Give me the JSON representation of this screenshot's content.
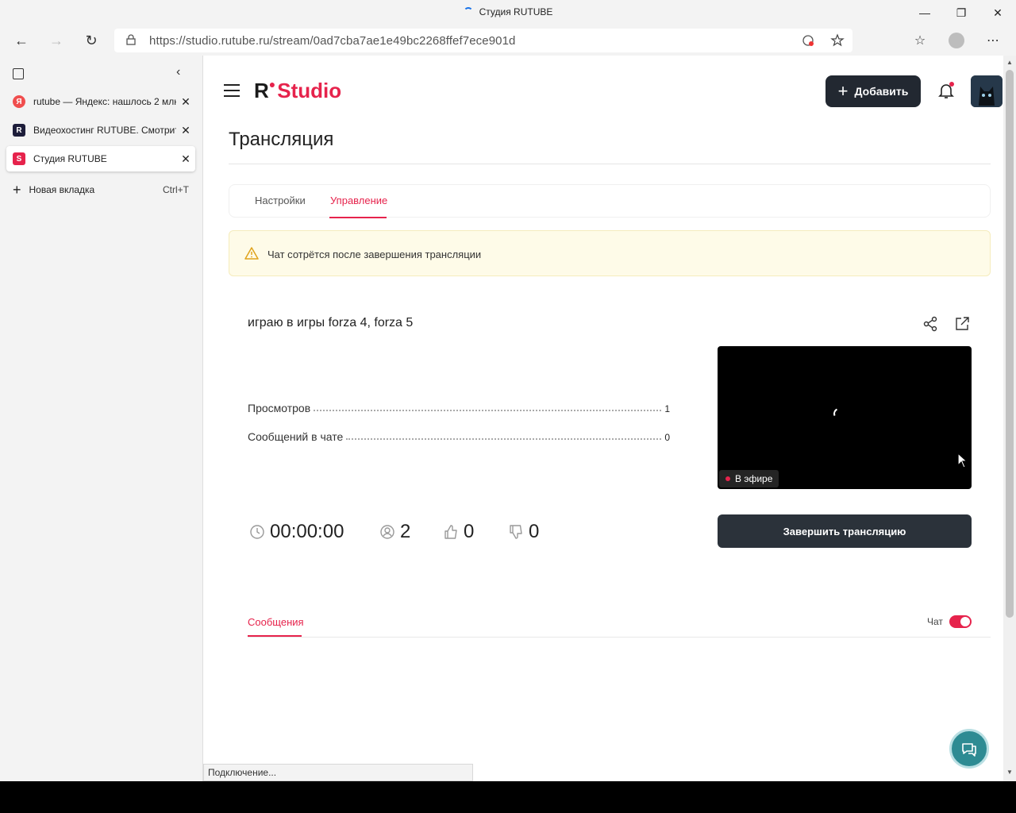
{
  "window": {
    "title": "Студия RUTUBE"
  },
  "browser": {
    "url": "https://studio.rutube.ru/stream/0ad7cba7ae1e49bc2268ffef7ece901d",
    "tabs": [
      {
        "label": "rutube — Яндекс: нашлось 2 млн результатов",
        "favicon": "Я",
        "favicon_color": "#f04e4e"
      },
      {
        "label": "Видеохостинг RUTUBE. Смотрите видео онлайн",
        "favicon": "R",
        "favicon_color": "#1d1d3a"
      },
      {
        "label": "Студия RUTUBE",
        "favicon": "S",
        "favicon_color": "#e6234c"
      }
    ],
    "new_tab": {
      "label": "Новая вкладка",
      "shortcut": "Ctrl+T"
    },
    "status_text": "Подключение..."
  },
  "app": {
    "logo_r": "R",
    "logo_studio": "Studio",
    "add_button": "Добавить",
    "page_title": "Трансляция",
    "tabs": [
      {
        "label": "Настройки"
      },
      {
        "label": "Управление"
      }
    ],
    "warning": "Чат сотрётся после завершения трансляции",
    "stream": {
      "name": "играю в игры forza 4, forza 5",
      "views_label": "Просмотров",
      "views_value": "1",
      "messages_label": "Сообщений в чате",
      "messages_value": "0",
      "live_label": "В эфире",
      "duration": "00:00:00",
      "viewers": "2",
      "likes": "0",
      "dislikes": "0",
      "end_button": "Завершить трансляцию"
    },
    "chat": {
      "messages_tab": "Сообщения",
      "chat_toggle_label": "Чат"
    }
  },
  "colors": {
    "accent": "#e6234c",
    "dark_button": "#222831",
    "warning_bg": "#fefbe8",
    "support": "#2e8b93"
  }
}
